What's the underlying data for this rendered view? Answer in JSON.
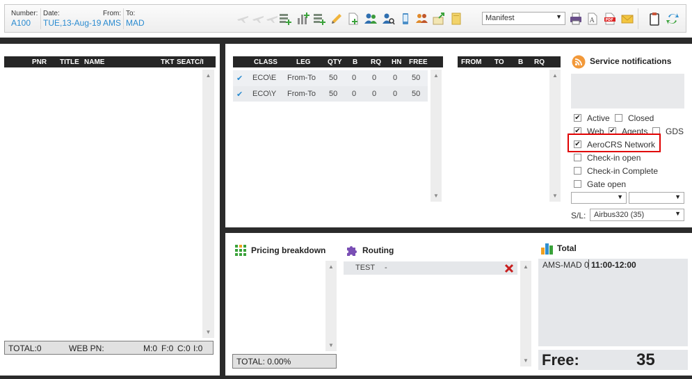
{
  "toolbar": {
    "number_label": "Number:",
    "number_value": "A100",
    "date_label": "Date:",
    "date_value": "TUE,13-Aug-19",
    "from_label": "From:",
    "from_value": "AMS",
    "to_label": "To:",
    "to_value": "MAD",
    "report_select": "Manifest"
  },
  "passengers": {
    "columns": [
      "PNR",
      "TITLE",
      "NAME",
      "TKT",
      "SEAT",
      "C/I"
    ],
    "footer": {
      "total": "TOTAL:0",
      "web": "WEB PN:",
      "m": "M:0",
      "f": "F:0",
      "c": "C:0",
      "i": "I:0"
    }
  },
  "classes": {
    "columns": [
      "CLASS",
      "LEG",
      "QTY",
      "B",
      "RQ",
      "HN",
      "FREE"
    ],
    "rows": [
      {
        "class": "ECO\\E",
        "leg": "From-To",
        "qty": "50",
        "b": "0",
        "rq": "0",
        "hn": "0",
        "free": "50"
      },
      {
        "class": "ECO\\Y",
        "leg": "From-To",
        "qty": "50",
        "b": "0",
        "rq": "0",
        "hn": "0",
        "free": "50"
      }
    ]
  },
  "legs": {
    "columns": [
      "FROM",
      "TO",
      "B",
      "RQ"
    ]
  },
  "notifications": {
    "title": "Service notifications",
    "active": "Active",
    "closed": "Closed",
    "web": "Web",
    "agents": "Agents",
    "gds": "GDS",
    "aerocrs": "AeroCRS Network",
    "checkin_open": "Check-in open",
    "checkin_complete": "Check-in Complete",
    "gate_open": "Gate open",
    "sl_label": "S/L:",
    "sl_value": "Airbus320 (35)"
  },
  "pricing": {
    "title": "Pricing breakdown",
    "total": "TOTAL:  0.00%"
  },
  "routing": {
    "title": "Routing",
    "rows": [
      {
        "name": "TEST",
        "value": "-"
      }
    ]
  },
  "total": {
    "title": "Total",
    "route": "AMS-MAD 0",
    "time": "11:00-12:00",
    "free_label": "Free:",
    "free_value": "35"
  },
  "colors": {
    "accent": "#2a8bd0",
    "highlight": "#e00000",
    "dark": "#2b2b2b"
  }
}
